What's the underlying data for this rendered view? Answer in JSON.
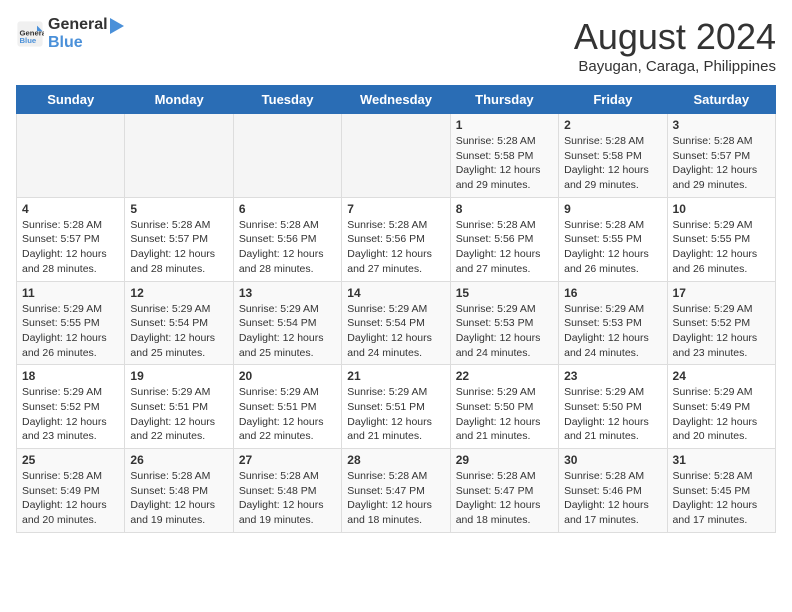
{
  "header": {
    "logo_general": "General",
    "logo_blue": "Blue",
    "month_year": "August 2024",
    "location": "Bayugan, Caraga, Philippines"
  },
  "weekdays": [
    "Sunday",
    "Monday",
    "Tuesday",
    "Wednesday",
    "Thursday",
    "Friday",
    "Saturday"
  ],
  "weeks": [
    [
      {
        "day": "",
        "info": ""
      },
      {
        "day": "",
        "info": ""
      },
      {
        "day": "",
        "info": ""
      },
      {
        "day": "",
        "info": ""
      },
      {
        "day": "1",
        "info": "Sunrise: 5:28 AM\nSunset: 5:58 PM\nDaylight: 12 hours\nand 29 minutes."
      },
      {
        "day": "2",
        "info": "Sunrise: 5:28 AM\nSunset: 5:58 PM\nDaylight: 12 hours\nand 29 minutes."
      },
      {
        "day": "3",
        "info": "Sunrise: 5:28 AM\nSunset: 5:57 PM\nDaylight: 12 hours\nand 29 minutes."
      }
    ],
    [
      {
        "day": "4",
        "info": "Sunrise: 5:28 AM\nSunset: 5:57 PM\nDaylight: 12 hours\nand 28 minutes."
      },
      {
        "day": "5",
        "info": "Sunrise: 5:28 AM\nSunset: 5:57 PM\nDaylight: 12 hours\nand 28 minutes."
      },
      {
        "day": "6",
        "info": "Sunrise: 5:28 AM\nSunset: 5:56 PM\nDaylight: 12 hours\nand 28 minutes."
      },
      {
        "day": "7",
        "info": "Sunrise: 5:28 AM\nSunset: 5:56 PM\nDaylight: 12 hours\nand 27 minutes."
      },
      {
        "day": "8",
        "info": "Sunrise: 5:28 AM\nSunset: 5:56 PM\nDaylight: 12 hours\nand 27 minutes."
      },
      {
        "day": "9",
        "info": "Sunrise: 5:28 AM\nSunset: 5:55 PM\nDaylight: 12 hours\nand 26 minutes."
      },
      {
        "day": "10",
        "info": "Sunrise: 5:29 AM\nSunset: 5:55 PM\nDaylight: 12 hours\nand 26 minutes."
      }
    ],
    [
      {
        "day": "11",
        "info": "Sunrise: 5:29 AM\nSunset: 5:55 PM\nDaylight: 12 hours\nand 26 minutes."
      },
      {
        "day": "12",
        "info": "Sunrise: 5:29 AM\nSunset: 5:54 PM\nDaylight: 12 hours\nand 25 minutes."
      },
      {
        "day": "13",
        "info": "Sunrise: 5:29 AM\nSunset: 5:54 PM\nDaylight: 12 hours\nand 25 minutes."
      },
      {
        "day": "14",
        "info": "Sunrise: 5:29 AM\nSunset: 5:54 PM\nDaylight: 12 hours\nand 24 minutes."
      },
      {
        "day": "15",
        "info": "Sunrise: 5:29 AM\nSunset: 5:53 PM\nDaylight: 12 hours\nand 24 minutes."
      },
      {
        "day": "16",
        "info": "Sunrise: 5:29 AM\nSunset: 5:53 PM\nDaylight: 12 hours\nand 24 minutes."
      },
      {
        "day": "17",
        "info": "Sunrise: 5:29 AM\nSunset: 5:52 PM\nDaylight: 12 hours\nand 23 minutes."
      }
    ],
    [
      {
        "day": "18",
        "info": "Sunrise: 5:29 AM\nSunset: 5:52 PM\nDaylight: 12 hours\nand 23 minutes."
      },
      {
        "day": "19",
        "info": "Sunrise: 5:29 AM\nSunset: 5:51 PM\nDaylight: 12 hours\nand 22 minutes."
      },
      {
        "day": "20",
        "info": "Sunrise: 5:29 AM\nSunset: 5:51 PM\nDaylight: 12 hours\nand 22 minutes."
      },
      {
        "day": "21",
        "info": "Sunrise: 5:29 AM\nSunset: 5:51 PM\nDaylight: 12 hours\nand 21 minutes."
      },
      {
        "day": "22",
        "info": "Sunrise: 5:29 AM\nSunset: 5:50 PM\nDaylight: 12 hours\nand 21 minutes."
      },
      {
        "day": "23",
        "info": "Sunrise: 5:29 AM\nSunset: 5:50 PM\nDaylight: 12 hours\nand 21 minutes."
      },
      {
        "day": "24",
        "info": "Sunrise: 5:29 AM\nSunset: 5:49 PM\nDaylight: 12 hours\nand 20 minutes."
      }
    ],
    [
      {
        "day": "25",
        "info": "Sunrise: 5:28 AM\nSunset: 5:49 PM\nDaylight: 12 hours\nand 20 minutes."
      },
      {
        "day": "26",
        "info": "Sunrise: 5:28 AM\nSunset: 5:48 PM\nDaylight: 12 hours\nand 19 minutes."
      },
      {
        "day": "27",
        "info": "Sunrise: 5:28 AM\nSunset: 5:48 PM\nDaylight: 12 hours\nand 19 minutes."
      },
      {
        "day": "28",
        "info": "Sunrise: 5:28 AM\nSunset: 5:47 PM\nDaylight: 12 hours\nand 18 minutes."
      },
      {
        "day": "29",
        "info": "Sunrise: 5:28 AM\nSunset: 5:47 PM\nDaylight: 12 hours\nand 18 minutes."
      },
      {
        "day": "30",
        "info": "Sunrise: 5:28 AM\nSunset: 5:46 PM\nDaylight: 12 hours\nand 17 minutes."
      },
      {
        "day": "31",
        "info": "Sunrise: 5:28 AM\nSunset: 5:45 PM\nDaylight: 12 hours\nand 17 minutes."
      }
    ]
  ]
}
